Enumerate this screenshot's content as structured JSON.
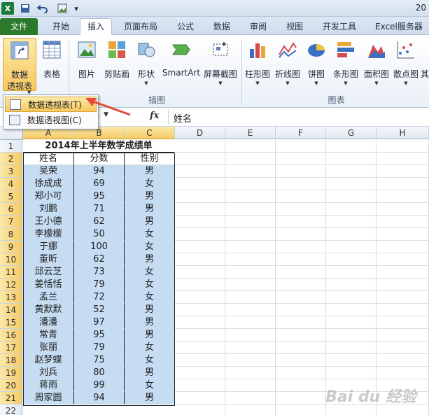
{
  "window": {
    "title_fragment": "20"
  },
  "quick_access": [
    "excel-icon",
    "save-icon",
    "undo-icon",
    "image-icon",
    "customize-icon"
  ],
  "tabs": [
    {
      "id": "file",
      "label": "文件"
    },
    {
      "id": "home",
      "label": "开始"
    },
    {
      "id": "insert",
      "label": "插入"
    },
    {
      "id": "layout",
      "label": "页面布局"
    },
    {
      "id": "formulas",
      "label": "公式"
    },
    {
      "id": "data",
      "label": "数据"
    },
    {
      "id": "review",
      "label": "审阅"
    },
    {
      "id": "view",
      "label": "视图"
    },
    {
      "id": "dev",
      "label": "开发工具"
    },
    {
      "id": "server",
      "label": "Excel服务器"
    }
  ],
  "ribbon": {
    "pivot": {
      "line1": "数据",
      "line2": "透视表"
    },
    "table": "表格",
    "picture": "图片",
    "clipart": "剪贴画",
    "shapes": "形状",
    "smartart": "SmartArt",
    "screenshot": "屏幕截图",
    "column": "柱形图",
    "line": "折线图",
    "pie": "饼图",
    "bar": "条形图",
    "area": "面积图",
    "scatter": "散点图",
    "other": "其",
    "group_illustrations": "插图",
    "group_charts": "图表"
  },
  "dropdown": {
    "item1": "数据透视表(T)",
    "item2": "数据透视图(C)"
  },
  "formula": {
    "fx": "fx",
    "value": "姓名"
  },
  "colors": {
    "accent": "#e24a3c",
    "selection": "#c5dcf3",
    "file_tab": "#2b7a2b"
  },
  "columns": [
    "A",
    "B",
    "C",
    "D",
    "E",
    "F",
    "G",
    "H"
  ],
  "rows": [
    "1",
    "2",
    "3",
    "4",
    "5",
    "6",
    "7",
    "8",
    "9",
    "10",
    "11",
    "12",
    "13",
    "14",
    "15",
    "16",
    "17",
    "18",
    "19",
    "20",
    "21",
    "22"
  ],
  "sheet": {
    "title": "2014年上半年数学成绩单",
    "header": [
      "姓名",
      "分数",
      "性别"
    ],
    "records": [
      [
        "吴荣",
        "94",
        "男"
      ],
      [
        "徐成成",
        "69",
        "女"
      ],
      [
        "郑小可",
        "95",
        "男"
      ],
      [
        "刘鹏",
        "71",
        "男"
      ],
      [
        "王小德",
        "62",
        "男"
      ],
      [
        "李檬檬",
        "50",
        "女"
      ],
      [
        "于娜",
        "100",
        "女"
      ],
      [
        "董昕",
        "62",
        "男"
      ],
      [
        "邱云芝",
        "73",
        "女"
      ],
      [
        "姜恬恬",
        "79",
        "女"
      ],
      [
        "孟兰",
        "72",
        "女"
      ],
      [
        "黄默默",
        "52",
        "男"
      ],
      [
        "潘潘",
        "97",
        "男"
      ],
      [
        "常青",
        "95",
        "男"
      ],
      [
        "张丽",
        "79",
        "女"
      ],
      [
        "赵梦蝶",
        "75",
        "女"
      ],
      [
        "刘兵",
        "80",
        "男"
      ],
      [
        "蒋雨",
        "99",
        "女"
      ],
      [
        "周家圆",
        "94",
        "男"
      ]
    ]
  },
  "watermark": "Bai du 经验"
}
